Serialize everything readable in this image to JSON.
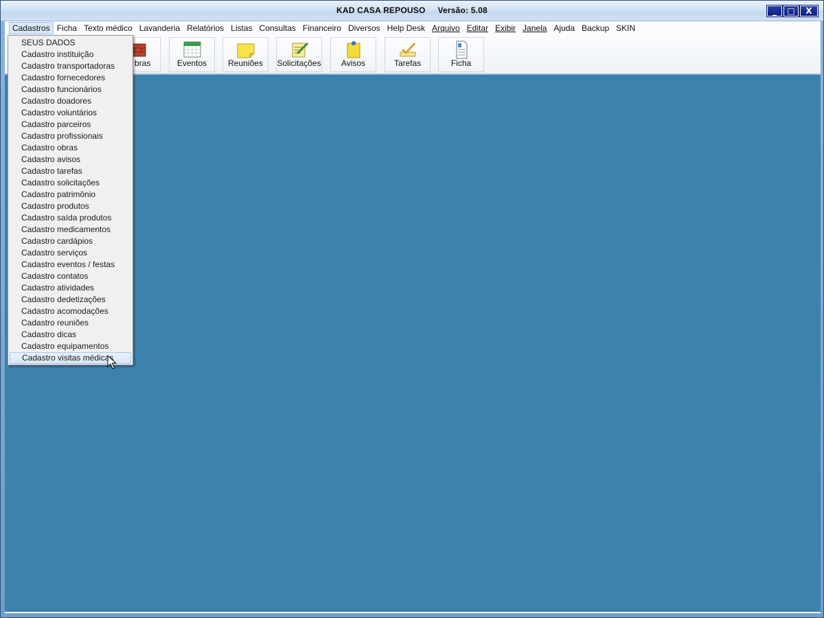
{
  "window": {
    "title": "KAD CASA REPOUSO",
    "version": "Versão: 5.08",
    "controls": {
      "minimize": "_",
      "maximize": "□",
      "close": "X"
    }
  },
  "menubar": {
    "items": [
      {
        "label": "Cadastros"
      },
      {
        "label": "Ficha"
      },
      {
        "label": "Texto médico"
      },
      {
        "label": "Lavanderia"
      },
      {
        "label": "Relatórios"
      },
      {
        "label": "Listas"
      },
      {
        "label": "Consultas"
      },
      {
        "label": "Financeiro"
      },
      {
        "label": "Diversos"
      },
      {
        "label": "Help Desk"
      },
      {
        "label": "Arquivo"
      },
      {
        "label": "Editar"
      },
      {
        "label": "Exibir"
      },
      {
        "label": "Janela"
      },
      {
        "label": "Ajuda"
      },
      {
        "label": "Backup"
      },
      {
        "label": "SKIN"
      }
    ]
  },
  "toolbar": {
    "buttons": [
      {
        "label": "bras",
        "icon": "bricks-icon"
      },
      {
        "label": "Eventos",
        "icon": "calendar-icon"
      },
      {
        "label": "Reuniões",
        "icon": "sticky-note-icon"
      },
      {
        "label": "Solicitações",
        "icon": "notepad-pencil-icon"
      },
      {
        "label": "Avisos",
        "icon": "pinned-note-icon"
      },
      {
        "label": "Tarefas",
        "icon": "checkmark-pencil-icon"
      },
      {
        "label": "Ficha",
        "icon": "document-icon"
      }
    ]
  },
  "dropdown": {
    "items": [
      "SEUS DADOS",
      "Cadastro instituição",
      "Cadastro transportadoras",
      "Cadastro fornecedores",
      "Cadastro funcionários",
      "Cadastro doadores",
      "Cadastro voluntários",
      "Cadastro parceiros",
      "Cadastro profissionais",
      "Cadastro obras",
      "Cadastro avisos",
      "Cadastro tarefas",
      "Cadastro solicitações",
      "Cadastro patrimônio",
      "Cadastro produtos",
      "Cadastro saída produtos",
      "Cadastro medicamentos",
      "Cadastro cardápios",
      "Cadastro serviços",
      "Cadastro eventos / festas",
      "Cadastro contatos",
      "Cadastro atividades",
      "Cadastro dedetizações",
      "Cadastro acomodações",
      "Cadastro reuniões",
      "Cadastro dicas",
      "Cadastro equipamentos",
      "Cadastro visitas médicas"
    ]
  },
  "colors": {
    "desktop": "#3d81ad",
    "menu_highlight": "#d8e6f5"
  }
}
